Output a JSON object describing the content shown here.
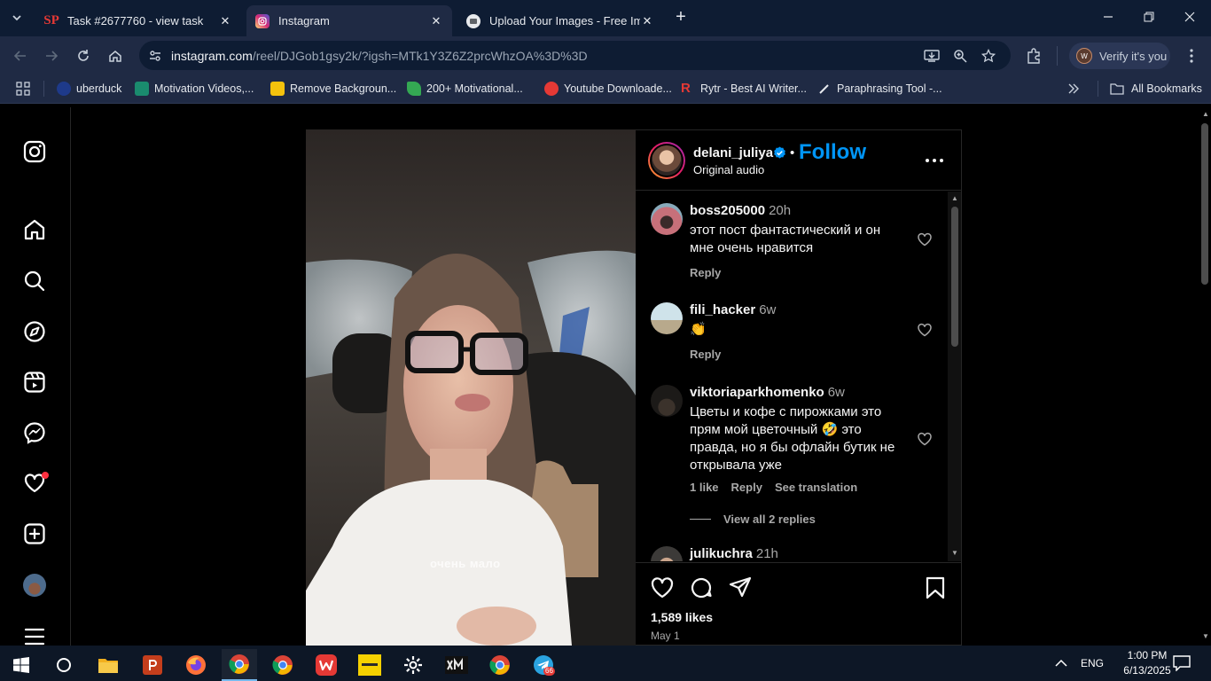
{
  "browser": {
    "tabs": [
      {
        "title": "Task #2677760 - view task",
        "favicon": "SP"
      },
      {
        "title": "Instagram",
        "favicon": "instagram"
      },
      {
        "title": "Upload Your Images - Free Imag",
        "favicon": "upload"
      }
    ],
    "url_host": "instagram.com",
    "url_path": "/reel/DJGob1gsy2k/?igsh=MTk1Y3Z6Z2prcWhzOA%3D%3D",
    "verify_label": "Verify it's you",
    "verify_avatar": "W",
    "bookmarks": [
      "uberduck",
      "Motivation Videos,...",
      "Remove Backgroun...",
      "200+ Motivational...",
      "Youtube Downloade...",
      "Rytr - Best AI Writer...",
      "Paraphrasing Tool -..."
    ],
    "all_bookmarks": "All Bookmarks"
  },
  "video": {
    "caption": "очень мало"
  },
  "post": {
    "username": "delani_juliya",
    "follow_label": "Follow",
    "separator": "•",
    "audio": "Original audio",
    "likes": "1,589 likes",
    "date": "May 1",
    "comments": [
      {
        "user": "boss205000",
        "time": "20h",
        "text": "этот пост фантастический и он мне очень нравится",
        "likes": "",
        "reply": "Reply",
        "translate": ""
      },
      {
        "user": "fili_hacker",
        "time": "6w",
        "text": "👏",
        "likes": "",
        "reply": "Reply",
        "translate": ""
      },
      {
        "user": "viktoriaparkhomenko",
        "time": "6w",
        "text": "Цветы и кофе с пирожками это прям мой цветочный 🤣 это правда, но я бы офлайн бутик не открывала уже",
        "likes": "1 like",
        "reply": "Reply",
        "translate": "See translation"
      },
      {
        "user": "julikuchra",
        "time": "21h",
        "text": "",
        "likes": "",
        "reply": "",
        "translate": ""
      }
    ],
    "view_replies": "View all 2 replies"
  },
  "taskbar": {
    "language": "ENG",
    "time": "1:00 PM",
    "date": "6/13/2025",
    "telegram_badge": "66"
  },
  "colors": {
    "accent": "#0095f6",
    "notification": "#ff3040",
    "chrome_bg": "#0e1c33",
    "toolbar_bg": "#1f2a44"
  }
}
